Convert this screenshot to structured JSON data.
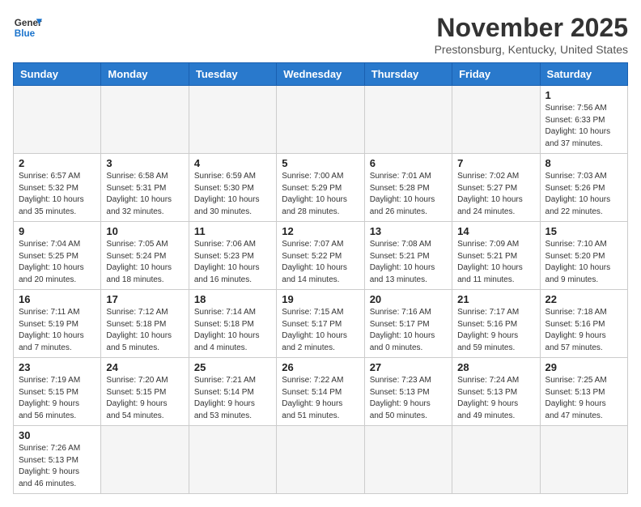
{
  "header": {
    "logo_line1": "General",
    "logo_line2": "Blue",
    "month_title": "November 2025",
    "location": "Prestonsburg, Kentucky, United States"
  },
  "days_of_week": [
    "Sunday",
    "Monday",
    "Tuesday",
    "Wednesday",
    "Thursday",
    "Friday",
    "Saturday"
  ],
  "weeks": [
    [
      {
        "day": "",
        "info": ""
      },
      {
        "day": "",
        "info": ""
      },
      {
        "day": "",
        "info": ""
      },
      {
        "day": "",
        "info": ""
      },
      {
        "day": "",
        "info": ""
      },
      {
        "day": "",
        "info": ""
      },
      {
        "day": "1",
        "info": "Sunrise: 7:56 AM\nSunset: 6:33 PM\nDaylight: 10 hours\nand 37 minutes."
      }
    ],
    [
      {
        "day": "2",
        "info": "Sunrise: 6:57 AM\nSunset: 5:32 PM\nDaylight: 10 hours\nand 35 minutes."
      },
      {
        "day": "3",
        "info": "Sunrise: 6:58 AM\nSunset: 5:31 PM\nDaylight: 10 hours\nand 32 minutes."
      },
      {
        "day": "4",
        "info": "Sunrise: 6:59 AM\nSunset: 5:30 PM\nDaylight: 10 hours\nand 30 minutes."
      },
      {
        "day": "5",
        "info": "Sunrise: 7:00 AM\nSunset: 5:29 PM\nDaylight: 10 hours\nand 28 minutes."
      },
      {
        "day": "6",
        "info": "Sunrise: 7:01 AM\nSunset: 5:28 PM\nDaylight: 10 hours\nand 26 minutes."
      },
      {
        "day": "7",
        "info": "Sunrise: 7:02 AM\nSunset: 5:27 PM\nDaylight: 10 hours\nand 24 minutes."
      },
      {
        "day": "8",
        "info": "Sunrise: 7:03 AM\nSunset: 5:26 PM\nDaylight: 10 hours\nand 22 minutes."
      }
    ],
    [
      {
        "day": "9",
        "info": "Sunrise: 7:04 AM\nSunset: 5:25 PM\nDaylight: 10 hours\nand 20 minutes."
      },
      {
        "day": "10",
        "info": "Sunrise: 7:05 AM\nSunset: 5:24 PM\nDaylight: 10 hours\nand 18 minutes."
      },
      {
        "day": "11",
        "info": "Sunrise: 7:06 AM\nSunset: 5:23 PM\nDaylight: 10 hours\nand 16 minutes."
      },
      {
        "day": "12",
        "info": "Sunrise: 7:07 AM\nSunset: 5:22 PM\nDaylight: 10 hours\nand 14 minutes."
      },
      {
        "day": "13",
        "info": "Sunrise: 7:08 AM\nSunset: 5:21 PM\nDaylight: 10 hours\nand 13 minutes."
      },
      {
        "day": "14",
        "info": "Sunrise: 7:09 AM\nSunset: 5:21 PM\nDaylight: 10 hours\nand 11 minutes."
      },
      {
        "day": "15",
        "info": "Sunrise: 7:10 AM\nSunset: 5:20 PM\nDaylight: 10 hours\nand 9 minutes."
      }
    ],
    [
      {
        "day": "16",
        "info": "Sunrise: 7:11 AM\nSunset: 5:19 PM\nDaylight: 10 hours\nand 7 minutes."
      },
      {
        "day": "17",
        "info": "Sunrise: 7:12 AM\nSunset: 5:18 PM\nDaylight: 10 hours\nand 5 minutes."
      },
      {
        "day": "18",
        "info": "Sunrise: 7:14 AM\nSunset: 5:18 PM\nDaylight: 10 hours\nand 4 minutes."
      },
      {
        "day": "19",
        "info": "Sunrise: 7:15 AM\nSunset: 5:17 PM\nDaylight: 10 hours\nand 2 minutes."
      },
      {
        "day": "20",
        "info": "Sunrise: 7:16 AM\nSunset: 5:17 PM\nDaylight: 10 hours\nand 0 minutes."
      },
      {
        "day": "21",
        "info": "Sunrise: 7:17 AM\nSunset: 5:16 PM\nDaylight: 9 hours\nand 59 minutes."
      },
      {
        "day": "22",
        "info": "Sunrise: 7:18 AM\nSunset: 5:16 PM\nDaylight: 9 hours\nand 57 minutes."
      }
    ],
    [
      {
        "day": "23",
        "info": "Sunrise: 7:19 AM\nSunset: 5:15 PM\nDaylight: 9 hours\nand 56 minutes."
      },
      {
        "day": "24",
        "info": "Sunrise: 7:20 AM\nSunset: 5:15 PM\nDaylight: 9 hours\nand 54 minutes."
      },
      {
        "day": "25",
        "info": "Sunrise: 7:21 AM\nSunset: 5:14 PM\nDaylight: 9 hours\nand 53 minutes."
      },
      {
        "day": "26",
        "info": "Sunrise: 7:22 AM\nSunset: 5:14 PM\nDaylight: 9 hours\nand 51 minutes."
      },
      {
        "day": "27",
        "info": "Sunrise: 7:23 AM\nSunset: 5:13 PM\nDaylight: 9 hours\nand 50 minutes."
      },
      {
        "day": "28",
        "info": "Sunrise: 7:24 AM\nSunset: 5:13 PM\nDaylight: 9 hours\nand 49 minutes."
      },
      {
        "day": "29",
        "info": "Sunrise: 7:25 AM\nSunset: 5:13 PM\nDaylight: 9 hours\nand 47 minutes."
      }
    ],
    [
      {
        "day": "30",
        "info": "Sunrise: 7:26 AM\nSunset: 5:13 PM\nDaylight: 9 hours\nand 46 minutes."
      },
      {
        "day": "",
        "info": ""
      },
      {
        "day": "",
        "info": ""
      },
      {
        "day": "",
        "info": ""
      },
      {
        "day": "",
        "info": ""
      },
      {
        "day": "",
        "info": ""
      },
      {
        "day": "",
        "info": ""
      }
    ]
  ]
}
